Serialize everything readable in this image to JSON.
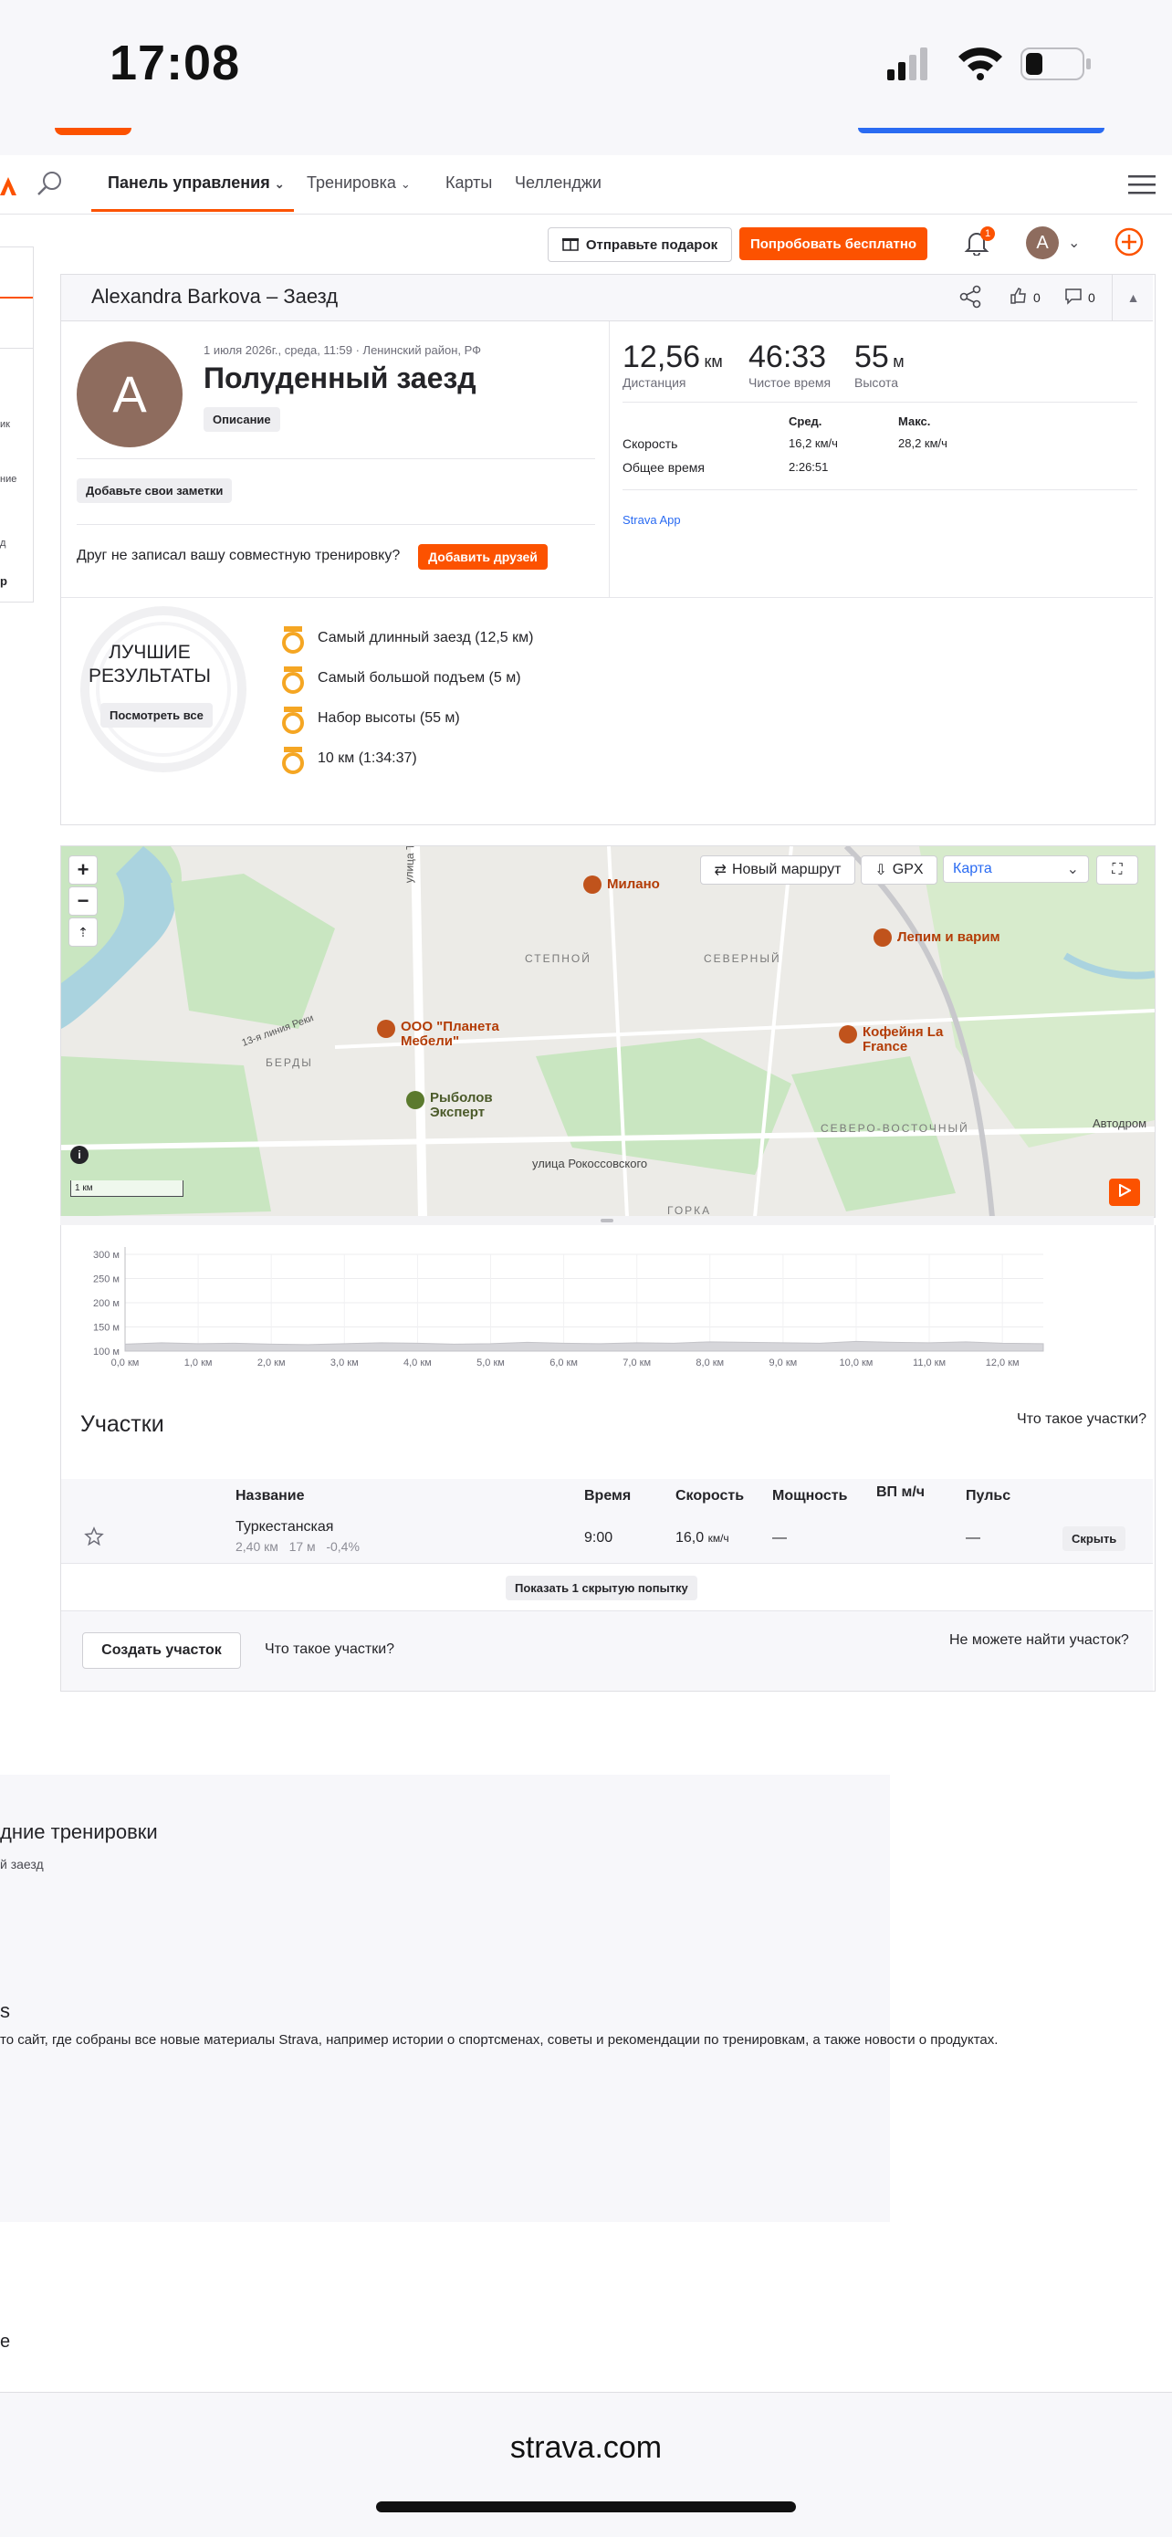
{
  "status_bar": {
    "time": "17:08"
  },
  "nav": {
    "items": [
      {
        "label": "Панель управления"
      },
      {
        "label": "Тренировка"
      },
      {
        "label": "Карты"
      },
      {
        "label": "Челленджи"
      }
    ]
  },
  "actions": {
    "gift_label": "Отправьте подарок",
    "trial_label": "Попробовать бесплатно",
    "notification_count": "1",
    "avatar_letter": "A"
  },
  "activity": {
    "header_title": "Alexandra Barkova – Заезд",
    "kudos_count": "0",
    "comments_count": "0",
    "avatar_letter": "A",
    "meta": "1 июля 2026г., среда, 11:59 · Ленинский район, РФ",
    "title": "Полуденный заезд",
    "description_label": "Описание",
    "notes_label": "Добавьте свои заметки",
    "friend_prompt": "Друг не записал вашу совместную тренировку?",
    "add_friends_label": "Добавить друзей",
    "stats": [
      {
        "value": "12,56",
        "unit": "км",
        "label": "Дистанция"
      },
      {
        "value": "46:33",
        "unit": "",
        "label": "Чистое время"
      },
      {
        "value": "55",
        "unit": "м",
        "label": "Высота"
      }
    ],
    "table_headers": {
      "avg": "Сред.",
      "max": "Макс."
    },
    "rows": [
      {
        "label": "Скорость",
        "avg": "16,2 км/ч",
        "max": "28,2 км/ч"
      },
      {
        "label": "Общее время",
        "avg": "2:26:51",
        "max": ""
      }
    ],
    "device": "Strava App"
  },
  "best": {
    "title_line1": "ЛУЧШИЕ",
    "title_line2": "РЕЗУЛЬТАТЫ",
    "see_all": "Посмотреть все",
    "items": [
      "Самый длинный заезд  (12,5 км)",
      "Самый большой подъем  (5 м)",
      "Набор высоты  (55 м)",
      "10 км  (1:34:37)"
    ]
  },
  "map": {
    "new_route": "Новый маршрут",
    "gpx": "GPX",
    "map_type": "Карта",
    "scale": "1 км",
    "pois": [
      "Милано",
      "Лепим и варим",
      "ООО \"Планета Мебели\"",
      "Кофейня La France",
      "Рыболов Эксперт"
    ],
    "districts": [
      "СТЕПНОЙ",
      "СЕВЕРНЫЙ",
      "БЕРДЫ",
      "СЕВЕРО-ВОСТОЧНЫЙ",
      "ГОРКА"
    ],
    "streets": [
      "улица Тер",
      "улица Рокоссовского",
      "13-я линия Реки",
      "Автодром"
    ]
  },
  "chart_data": {
    "type": "area",
    "x": [
      0,
      0.5,
      1,
      1.5,
      2,
      2.5,
      3,
      3.5,
      4,
      4.5,
      5,
      5.5,
      6,
      6.5,
      7,
      7.5,
      8,
      8.5,
      9,
      9.5,
      10,
      10.5,
      11,
      11.5,
      12,
      12.56
    ],
    "values": [
      115,
      118,
      116,
      117,
      115,
      114,
      116,
      118,
      117,
      115,
      116,
      119,
      117,
      116,
      118,
      117,
      120,
      119,
      118,
      117,
      121,
      119,
      118,
      120,
      117,
      116
    ],
    "ylim": [
      100,
      300
    ],
    "xlim": [
      0,
      12.56
    ],
    "y_ticks": [
      "300 м",
      "250 м",
      "200 м",
      "150 м",
      "100 м"
    ],
    "x_ticks": [
      "0,0 км",
      "1,0 км",
      "2,0 км",
      "3,0 км",
      "4,0 км",
      "5,0 км",
      "6,0 км",
      "7,0 км",
      "8,0 км",
      "9,0 км",
      "10,0 км",
      "11,0 км",
      "12,0 км"
    ],
    "grid": true
  },
  "segments": {
    "title": "Участки",
    "what_are": "Что такое участки?",
    "headers": [
      "Название",
      "Время",
      "Скорость",
      "Мощность",
      "ВП м/ч",
      "Пульс"
    ],
    "rows": [
      {
        "name": "Туркестанская",
        "dist": "2,40 км",
        "elev": "17 м",
        "grade": "-0,4%",
        "time": "9:00",
        "speed": "16,0",
        "speed_unit": "км/ч",
        "power": "—",
        "vam": "",
        "hr": "—",
        "action": "Скрыть"
      }
    ],
    "show_hidden": "Показать 1 скрытую попытку",
    "create": "Создать участок",
    "what_are_2": "Что такое участки?",
    "cant_find": "Не можете найти участок?"
  },
  "lower": {
    "recent_title": "дние тренировки",
    "recent_item": "й заезд",
    "stories_letter": "s",
    "stories_text": "то сайт, где собраны все новые материалы Strava, например истории о спортсменах, советы и рекомендации по тренировкам, а также новости о продуктах.",
    "bottom_letter": "e"
  },
  "browser": {
    "url": "strava.com"
  },
  "colors": {
    "brand": "#fc5200",
    "map_bg": "#ecebe7",
    "park": "#c9e6c1",
    "water": "#aad3df"
  }
}
